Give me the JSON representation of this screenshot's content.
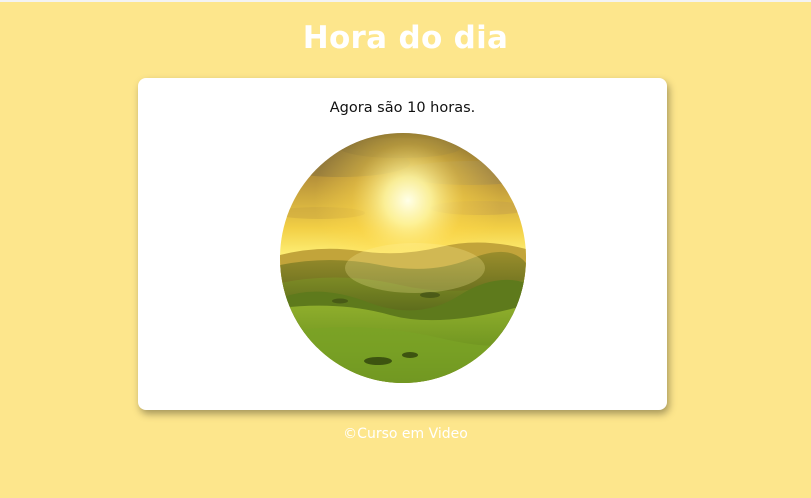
{
  "header": {
    "title": "Hora do dia"
  },
  "card": {
    "message": "Agora são 10 horas.",
    "image": {
      "icon": "landscape-sunrise-image"
    }
  },
  "footer": {
    "text": "©Curso em Video"
  },
  "colors": {
    "background": "#fde68c",
    "card": "#ffffff",
    "title": "#ffffff",
    "footer_text": "#ffffff",
    "message_text": "#111111"
  }
}
